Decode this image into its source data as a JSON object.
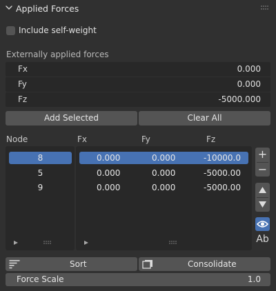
{
  "panel": {
    "title": "Applied Forces",
    "include_self_weight_label": "Include self-weight",
    "externally_applied_label": "Externally applied forces"
  },
  "forces": [
    {
      "label": "Fx",
      "value": "0.000"
    },
    {
      "label": "Fy",
      "value": "0.000"
    },
    {
      "label": "Fz",
      "value": "-5000.000"
    }
  ],
  "buttons": {
    "add_selected": "Add Selected",
    "clear_all": "Clear All"
  },
  "node_table": {
    "headers": {
      "node": "Node",
      "fx": "Fx",
      "fy": "Fy",
      "fz": "Fz"
    },
    "rows": [
      {
        "node": "8",
        "fx": "0.000",
        "fy": "0.000",
        "fz": "-10000.0",
        "selected": true
      },
      {
        "node": "5",
        "fx": "0.000",
        "fy": "0.000",
        "fz": "-5000.00",
        "selected": false
      },
      {
        "node": "9",
        "fx": "0.000",
        "fy": "0.000",
        "fz": "-5000.00",
        "selected": false
      }
    ]
  },
  "side_controls": {
    "add_glyph": "+",
    "remove_glyph": "−",
    "text_toggle": "Ab"
  },
  "actions": {
    "sort": "Sort",
    "consolidate": "Consolidate"
  },
  "force_scale": {
    "label": "Force Scale",
    "value": "1.0"
  },
  "colors": {
    "background": "#303030",
    "field": "#282828",
    "button": "#545454",
    "selection": "#4772b3"
  }
}
